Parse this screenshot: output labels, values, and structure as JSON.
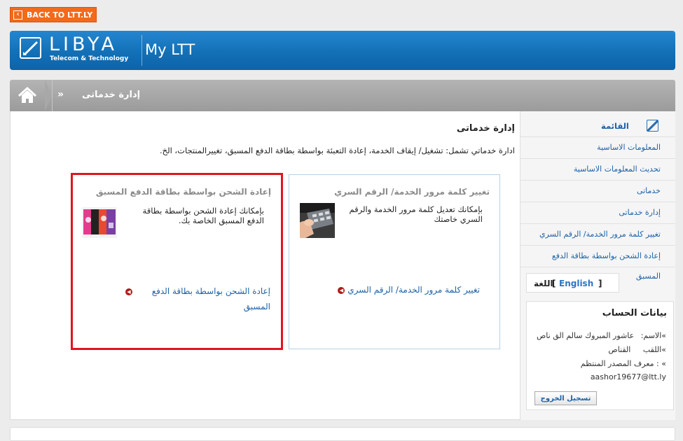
{
  "top": {
    "back_label": "BACK TO LTT.LY"
  },
  "header": {
    "logo_main": "LIBYA",
    "logo_sub": "Telecom & Technology",
    "app_title": "My LTT"
  },
  "breadcrumb": {
    "separator": "»",
    "current": "إدارة خدماتى"
  },
  "content": {
    "title": "إدارة خدماتى",
    "description": "ادارة خدماتي تشمل: تشغيل/ إيقاف الخدمة، إعادة التعبئة بواسطة بطاقة الدفع المسبق، تغييرالمنتجات، الخ."
  },
  "cards": {
    "password": {
      "title": "تغيير كلمة مرور الخدمة/ الرقم السري",
      "text": "بإمكانك تعديل كلمة مرور الخدمة والرقم السري خاصتك",
      "link": "تغيير كلمة مرور الخدمة/ الرقم السري"
    },
    "topup": {
      "title": "إعادة الشحن بواسطة بطاقة الدفع المسبق",
      "text": "بإمكانك إعادة الشحن بواسطة بطاقة الدفع المسبق الخاصة بك.",
      "link_line1": "إعادة الشحن بواسطة بطاقة الدفع",
      "link_line2": "المسبق"
    }
  },
  "sidebar": {
    "menu_label": "القائمة",
    "items": [
      {
        "label": "المعلومات الاساسية"
      },
      {
        "label": "تحديث المعلومات الاساسية"
      },
      {
        "label": "خدماتى"
      },
      {
        "label": "إدارة خدماتى"
      },
      {
        "label": "تغيير كلمة مرور الخدمة/ الرقم السري"
      },
      {
        "label": "إعادة الشحن بواسطة بطاقة الدفع"
      },
      {
        "label": "المسبق"
      }
    ],
    "language_label": "اللغة",
    "language_link": "English",
    "bracket_open": "[",
    "bracket_close": "]"
  },
  "account": {
    "title": "بيانات الحساب",
    "name_label": "»الاسم:",
    "name_value": "عاشور المبروك سالم الق ناص",
    "surname_label": "»اللقب",
    "surname_value": "القناص",
    "id_label": "» : معرف المصدر المنتظم",
    "email": "aashor19677@ltt.ly",
    "logout_label": "تسجيل الخروج"
  },
  "colors": {
    "accent_orange": "#f26a1b",
    "header_blue": "#1370b7",
    "highlight_red": "#e0151f",
    "link_blue": "#1d62a8"
  }
}
